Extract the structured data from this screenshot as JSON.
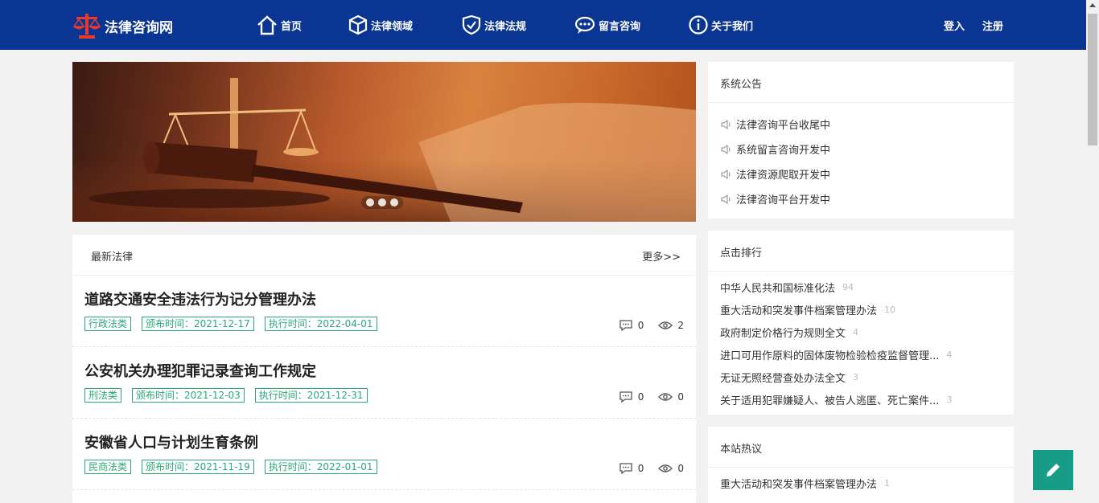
{
  "header": {
    "logo_text": "法律咨询网",
    "nav": [
      {
        "label": "首页",
        "icon": "home-icon"
      },
      {
        "label": "法律领域",
        "icon": "cube-icon"
      },
      {
        "label": "法律法规",
        "icon": "shield-check-icon"
      },
      {
        "label": "留言咨询",
        "icon": "chat-bubble-icon"
      },
      {
        "label": "关于我们",
        "icon": "info-icon"
      }
    ],
    "login": "登入",
    "register": "注册"
  },
  "banner": {
    "active_slide": 1,
    "slide_count": 3
  },
  "latest": {
    "title": "最新法律",
    "more": "更多>>",
    "items": [
      {
        "title": "道路交通安全违法行为记分管理办法",
        "category": "行政法类",
        "published": "颁布时间：2021-12-17",
        "effective": "执行时间：2022-04-01",
        "comments": "0",
        "views": "2"
      },
      {
        "title": "公安机关办理犯罪记录查询工作规定",
        "category": "刑法类",
        "published": "颁布时间：2021-12-03",
        "effective": "执行时间：2021-12-31",
        "comments": "0",
        "views": "0"
      },
      {
        "title": "安徽省人口与计划生育条例",
        "category": "民商法类",
        "published": "颁布时间：2021-11-19",
        "effective": "执行时间：2022-01-01",
        "comments": "0",
        "views": "0"
      }
    ]
  },
  "notices": {
    "title": "系统公告",
    "items": [
      "法律咨询平台收尾中",
      "系统留言咨询开发中",
      "法律资源爬取开发中",
      "法律咨询平台开发中"
    ]
  },
  "ranking": {
    "title": "点击排行",
    "items": [
      {
        "text": "中华人民共和国标准化法",
        "count": "94"
      },
      {
        "text": "重大活动和突发事件档案管理办法",
        "count": "10"
      },
      {
        "text": "政府制定价格行为规则全文",
        "count": "4"
      },
      {
        "text": "进口可用作原料的固体废物检验检疫监督管理...",
        "count": "4"
      },
      {
        "text": "无证无照经营查处办法全文",
        "count": "3"
      },
      {
        "text": "关于适用犯罪嫌疑人、被告人逃匿、死亡案件...",
        "count": "3"
      }
    ]
  },
  "hot": {
    "title": "本站热议",
    "items": [
      {
        "text": "重大活动和突发事件档案管理办法",
        "count": "1"
      }
    ]
  },
  "colors": {
    "navbar": "#0b3592",
    "tag": "#2aa876",
    "fab": "#169c87",
    "logo_red": "#e8392d"
  }
}
